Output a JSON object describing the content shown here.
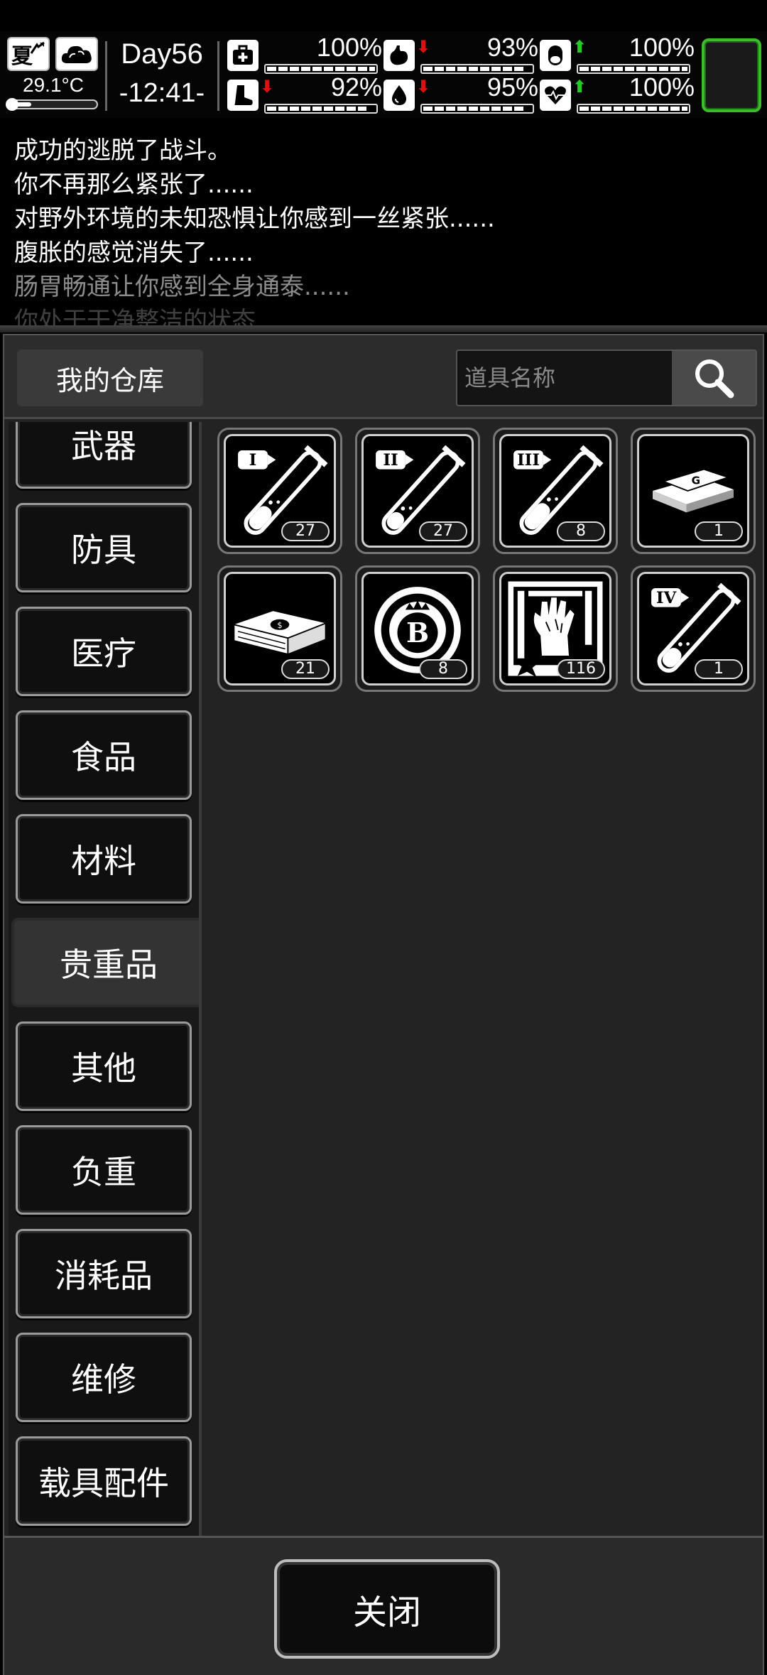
{
  "hud": {
    "season": "夏",
    "temperature": "29.1°C",
    "temperature_level": 0.25,
    "day": "Day56",
    "time": "-12:41-",
    "stats": [
      {
        "icon": "medkit-icon",
        "value": "100%",
        "trend": "",
        "level": 1.0
      },
      {
        "icon": "stomach-icon",
        "value": "93%",
        "trend": "down",
        "level": 0.93
      },
      {
        "icon": "pill-icon",
        "value": "100%",
        "trend": "up",
        "level": 1.0
      },
      {
        "icon": "boot-icon",
        "value": "92%",
        "trend": "down",
        "level": 0.92
      },
      {
        "icon": "water-drop-icon",
        "value": "95%",
        "trend": "down",
        "level": 0.95
      },
      {
        "icon": "heart-icon",
        "value": "100%",
        "trend": "up",
        "level": 1.0
      }
    ],
    "colors": {
      "arrow_up": "#22cc22",
      "arrow_down": "#dd1111",
      "portrait_border": "#3dbb2d"
    }
  },
  "log": [
    "成功的逃脱了战斗。",
    "你不再那么紧张了......",
    "对野外环境的未知恐惧让你感到一丝紧张......",
    "腹胀的感觉消失了......",
    "肠胃畅通让你感到全身通泰......",
    "你处于干净整洁的状态"
  ],
  "warehouse": {
    "title": "我的仓库",
    "search_placeholder": "道具名称",
    "categories": [
      "武器",
      "防具",
      "医疗",
      "食品",
      "材料",
      "贵重品",
      "其他",
      "负重",
      "消耗品",
      "维修",
      "载具配件"
    ],
    "active_category": "贵重品",
    "items": [
      {
        "name": "vial-level-1-icon",
        "count": "27"
      },
      {
        "name": "vial-level-2-icon",
        "count": "27"
      },
      {
        "name": "vial-level-3-icon",
        "count": "8"
      },
      {
        "name": "gold-bars-icon",
        "count": "1"
      },
      {
        "name": "cash-stack-icon",
        "count": "21"
      },
      {
        "name": "casino-chip-icon",
        "count": "8"
      },
      {
        "name": "zombie-hand-card-icon",
        "count": "116"
      },
      {
        "name": "vial-level-4-icon",
        "count": "1"
      }
    ],
    "close_label": "关闭"
  }
}
